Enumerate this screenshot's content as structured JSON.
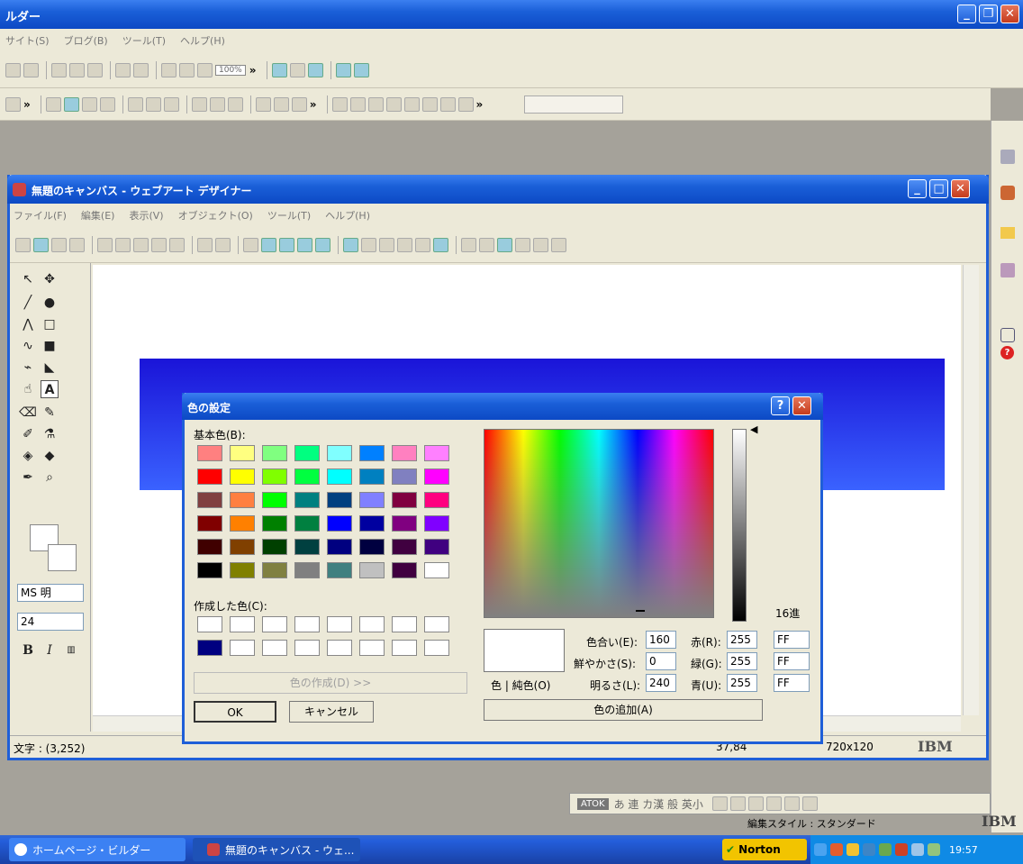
{
  "main_window": {
    "title": "ルダー",
    "menu": [
      "サイト(S)",
      "ブログ(B)",
      "ツール(T)",
      "ヘルプ(H)"
    ],
    "zoom": "100%"
  },
  "canvas_window": {
    "title": "無題のキャンバス - ウェブアート デザイナー",
    "menu": [
      "ファイル(F)",
      "編集(E)",
      "表示(V)",
      "オブジェクト(O)",
      "ツール(T)",
      "ヘルプ(H)"
    ],
    "font_name": "MS 明",
    "font_size": "24",
    "status_text": "文字 : (3,252)",
    "status_coords": "37,84",
    "status_size": "720x120",
    "brand": "IBM"
  },
  "dialog": {
    "title": "色の設定",
    "basic_label": "基本色(B):",
    "custom_label": "作成した色(C):",
    "define_button": "色の作成(D) >>",
    "ok": "OK",
    "cancel": "キャンセル",
    "color_solid": "色 | 純色(O)",
    "add_button": "色の追加(A)",
    "hex_label": "16進",
    "hue_label": "色合い(E):",
    "hue": "160",
    "sat_label": "鮮やかさ(S):",
    "sat": "0",
    "lum_label": "明るさ(L):",
    "lum": "240",
    "red_label": "赤(R):",
    "red": "255",
    "green_label": "緑(G):",
    "green": "255",
    "blue_label": "青(U):",
    "blue": "255",
    "hex_r": "FF",
    "hex_g": "FF",
    "hex_b": "FF",
    "basic_colors": [
      "#ff8080",
      "#ffff80",
      "#80ff80",
      "#00ff80",
      "#80ffff",
      "#0080ff",
      "#ff80c0",
      "#ff80ff",
      "#ff0000",
      "#ffff00",
      "#80ff00",
      "#00ff40",
      "#00ffff",
      "#0080c0",
      "#8080c0",
      "#ff00ff",
      "#804040",
      "#ff8040",
      "#00ff00",
      "#008080",
      "#004080",
      "#8080ff",
      "#800040",
      "#ff0080",
      "#800000",
      "#ff8000",
      "#008000",
      "#008040",
      "#0000ff",
      "#0000a0",
      "#800080",
      "#8000ff",
      "#400000",
      "#804000",
      "#004000",
      "#004040",
      "#000080",
      "#000040",
      "#400040",
      "#400080",
      "#000000",
      "#808000",
      "#808040",
      "#808080",
      "#408080",
      "#c0c0c0",
      "#400040",
      "#ffffff"
    ],
    "custom_colors": [
      "#ffffff",
      "#ffffff",
      "#ffffff",
      "#ffffff",
      "#ffffff",
      "#ffffff",
      "#ffffff",
      "#ffffff",
      "#000080",
      "#ffffff",
      "#ffffff",
      "#ffffff",
      "#ffffff",
      "#ffffff",
      "#ffffff",
      "#ffffff"
    ]
  },
  "ime": {
    "label": "ATOK",
    "chars": "あ 連 カ漢 般 英小",
    "style": "編集スタイル : スタンダード"
  },
  "taskbar": {
    "item1": "ホームページ・ビルダー",
    "item2": "無題のキャンバス - ウェ...",
    "norton": "Norton",
    "clock": "19:57",
    "brand": "IBM"
  }
}
